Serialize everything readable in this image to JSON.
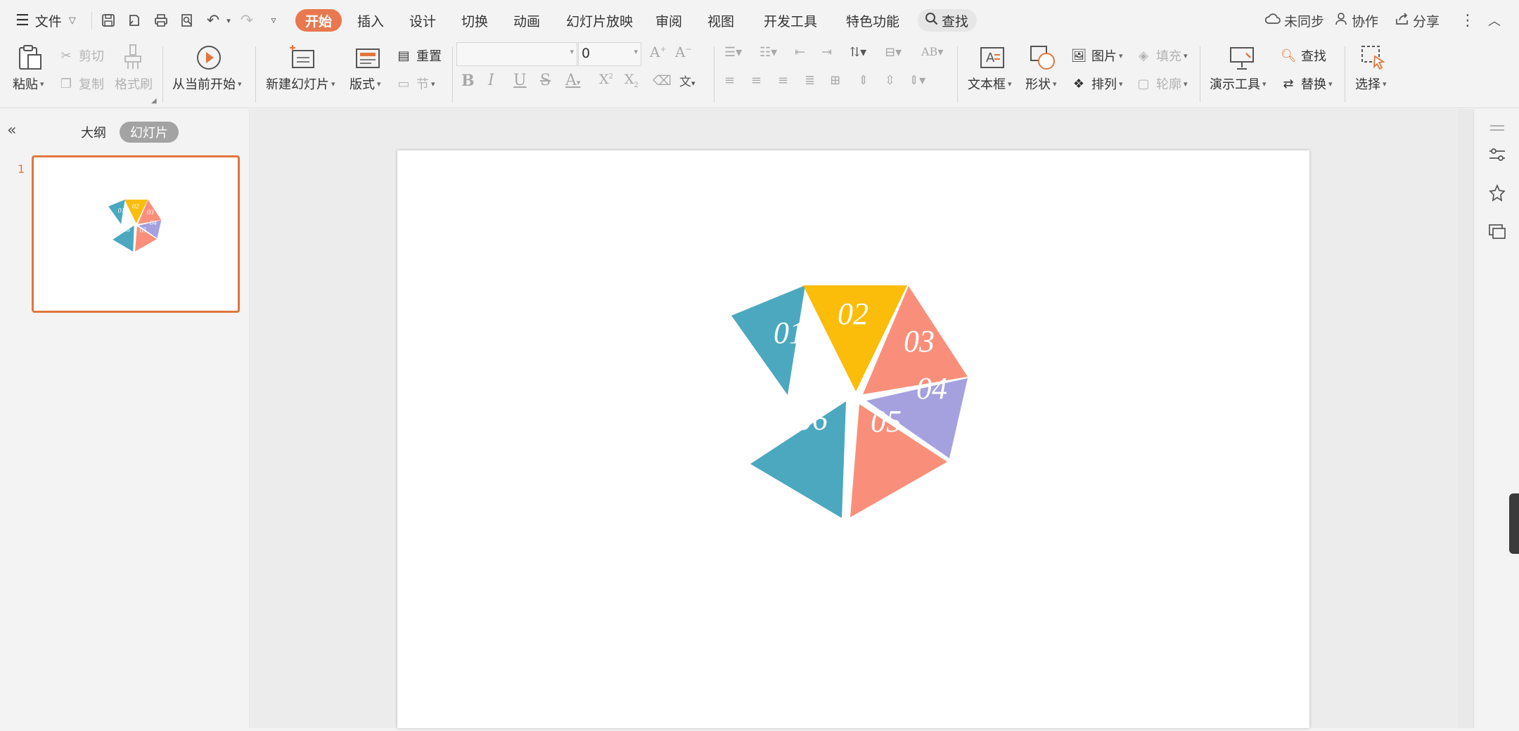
{
  "menubar": {
    "file_menu": "文件",
    "tabs": [
      {
        "label": "开始",
        "active": true
      },
      {
        "label": "插入"
      },
      {
        "label": "设计"
      },
      {
        "label": "切换"
      },
      {
        "label": "动画"
      },
      {
        "label": "幻灯片放映"
      },
      {
        "label": "审阅"
      },
      {
        "label": "视图"
      },
      {
        "label": "开发工具"
      },
      {
        "label": "特色功能"
      }
    ],
    "search_label": "查找",
    "sync_status": "未同步",
    "collaborate": "协作",
    "share": "分享"
  },
  "ribbon": {
    "paste": "粘贴",
    "cut": "剪切",
    "copy": "复制",
    "format_painter": "格式刷",
    "play_from_current": "从当前开始",
    "new_slide": "新建幻灯片",
    "layout": "版式",
    "reset": "重置",
    "section": "节",
    "font_name": "",
    "font_size": "0",
    "text_box": "文本框",
    "shape": "形状",
    "picture": "图片",
    "fill": "填充",
    "arrange": "排列",
    "outline": "轮廓",
    "presentation_tools": "演示工具",
    "find": "查找",
    "replace": "替换",
    "select": "选择"
  },
  "left_panel": {
    "outline_tab": "大纲",
    "slides_tab": "幻灯片",
    "slide_number": "1"
  },
  "slide": {
    "segments": [
      {
        "label": "01",
        "color": "#4ba8bf"
      },
      {
        "label": "02",
        "color": "#fbbd0a"
      },
      {
        "label": "03",
        "color": "#f98f7a"
      },
      {
        "label": "04",
        "color": "#a5a1df"
      },
      {
        "label": "05",
        "color": "#f98f7a"
      },
      {
        "label": "06",
        "color": "#4ba8bf"
      }
    ]
  },
  "colors": {
    "accent": "#e8784f",
    "thumbnail_border": "#e0763f"
  }
}
